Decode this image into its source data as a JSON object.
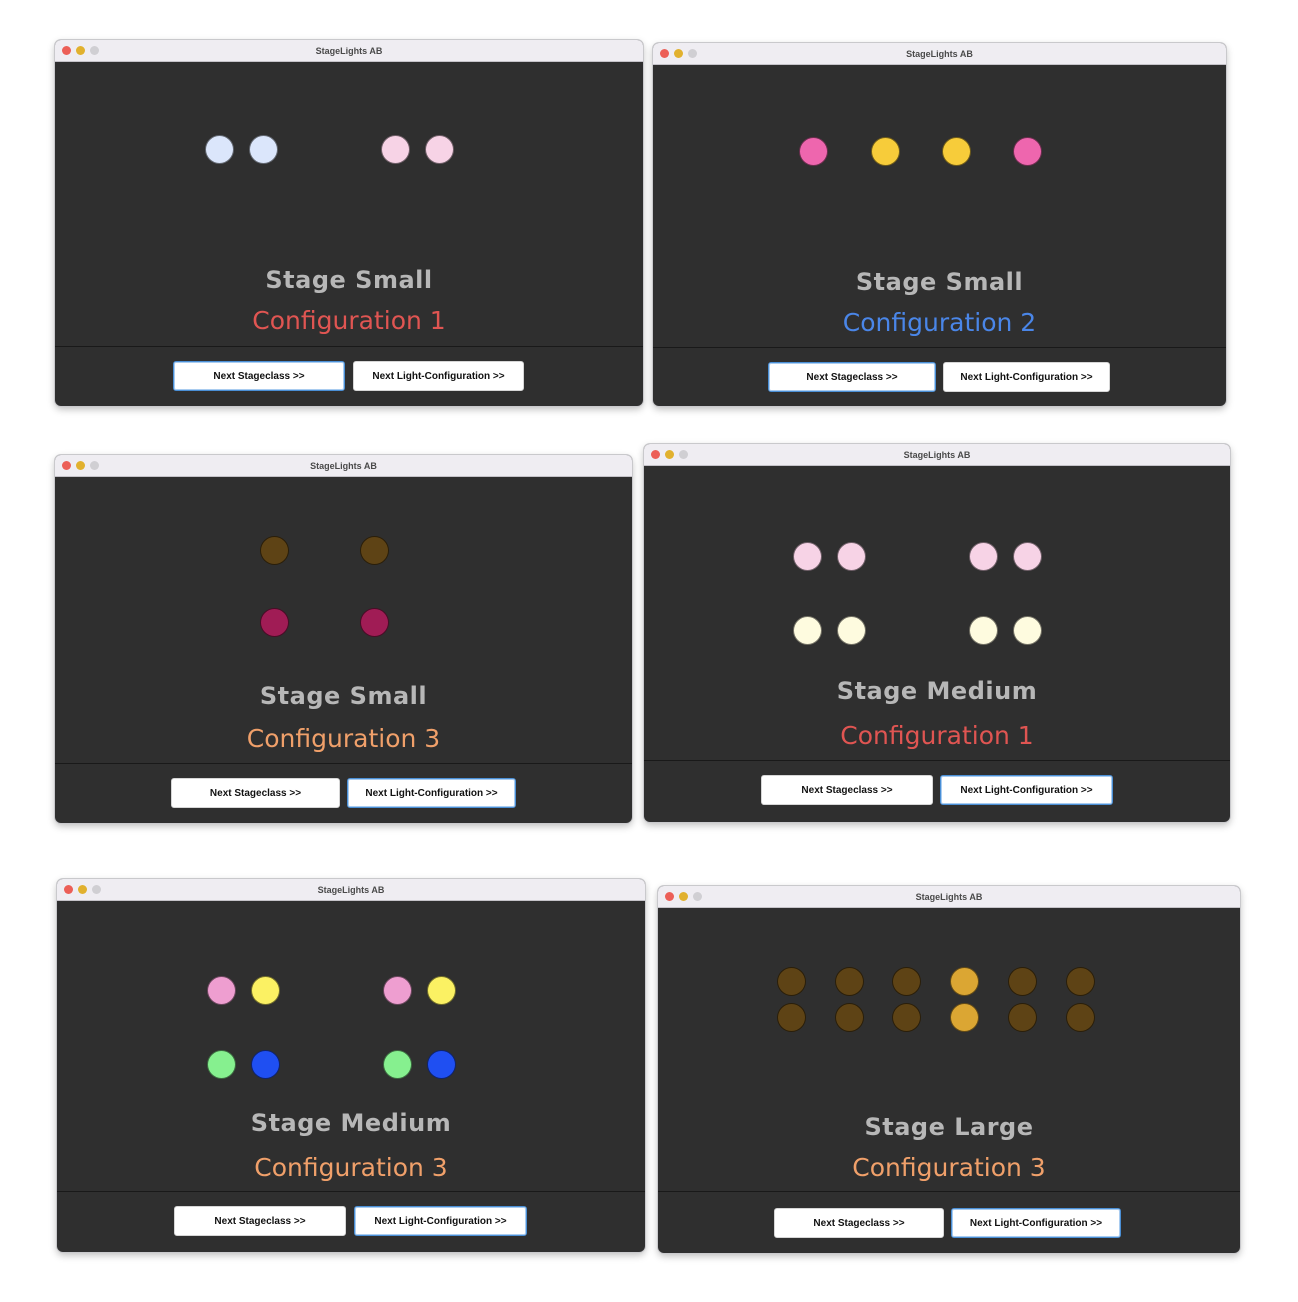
{
  "app_title": "StageLights AB",
  "buttons": {
    "next_stageclass": "Next Stageclass >>",
    "next_light_config": "Next Light-Configuration >>"
  },
  "colors": {
    "background": "#2f2f2f",
    "stage_text": "#b7b7b7",
    "config_1": "#e05552",
    "config_2": "#4a86e8",
    "config_3": "#f0a06a"
  },
  "windows": [
    {
      "title": "StageLights AB",
      "stage": "Stage Small",
      "configuration": "Configuration 1",
      "config_color": "#e05552",
      "light_colors": [
        "#dbe6fb",
        "#dbe6fb",
        "#f7d3e6",
        "#f7d3e6"
      ]
    },
    {
      "title": "StageLights AB",
      "stage": "Stage Small",
      "configuration": "Configuration 2",
      "config_color": "#4a86e8",
      "light_colors": [
        "#ee66ae",
        "#f7cc3a",
        "#f7cc3a",
        "#ee66ae"
      ]
    },
    {
      "title": "StageLights AB",
      "stage": "Stage Small",
      "configuration": "Configuration 3",
      "config_color": "#f0a06a",
      "light_colors": [
        "#5e4315",
        "#5e4315",
        "#a01c55",
        "#a01c55"
      ]
    },
    {
      "title": "StageLights AB",
      "stage": "Stage Medium",
      "configuration": "Configuration 1",
      "config_color": "#e05552",
      "light_colors": [
        "#f7d3e6",
        "#f7d3e6",
        "#f7d3e6",
        "#f7d3e6",
        "#fefbdf",
        "#fefbdf",
        "#fefbdf",
        "#fefbdf"
      ]
    },
    {
      "title": "StageLights AB",
      "stage": "Stage Medium",
      "configuration": "Configuration 3",
      "config_color": "#f0a06a",
      "light_colors": [
        "#ee9ed0",
        "#fbf163",
        "#ee9ed0",
        "#fbf163",
        "#86f08f",
        "#1f4ff2",
        "#86f08f",
        "#1f4ff2"
      ]
    },
    {
      "title": "StageLights AB",
      "stage": "Stage Large",
      "configuration": "Configuration 3",
      "config_color": "#f0a06a",
      "light_colors": [
        "#5e4315",
        "#5e4315",
        "#5e4315",
        "#dba633",
        "#5e4315",
        "#5e4315",
        "#5e4315",
        "#5e4315",
        "#5e4315",
        "#dba633",
        "#5e4315",
        "#5e4315"
      ]
    }
  ]
}
